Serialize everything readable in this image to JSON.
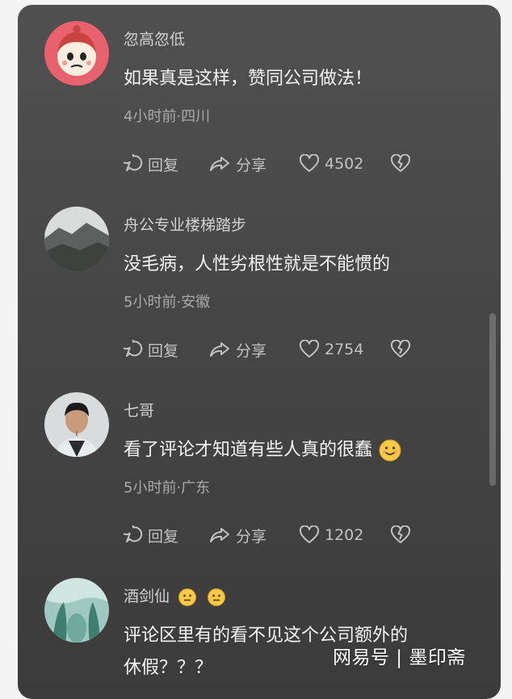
{
  "comments": [
    {
      "username": "忽高忽低",
      "text": "如果真是这样，赞同公司做法！",
      "meta": "4小时前·四川",
      "reply": "回复",
      "share": "分享",
      "likes": "4502"
    },
    {
      "username": "舟公专业楼梯踏步",
      "text": "没毛病，人性劣根性就是不能惯的",
      "meta": "5小时前·安徽",
      "reply": "回复",
      "share": "分享",
      "likes": "2754"
    },
    {
      "username": "七哥",
      "text": "看了评论才知道有些人真的很蠢",
      "meta": "5小时前·广东",
      "reply": "回复",
      "share": "分享",
      "likes": "1202"
    },
    {
      "username": "酒剑仙",
      "text_line1": "评论区里有的看不见这个公司额外的",
      "text_line2": "休假？？？"
    }
  ],
  "watermark": "网易号 | 墨印斋",
  "colors": {
    "panel": "#484848",
    "text": "#f2f2f2",
    "secondary": "#a9a9a9",
    "avatar1_bg": "#e8626e"
  },
  "icons": [
    "comment-bubble-icon",
    "share-arrow-icon",
    "heart-icon",
    "broken-heart-icon",
    "smiling-emoji-icon",
    "neutral-emoji-icon"
  ]
}
